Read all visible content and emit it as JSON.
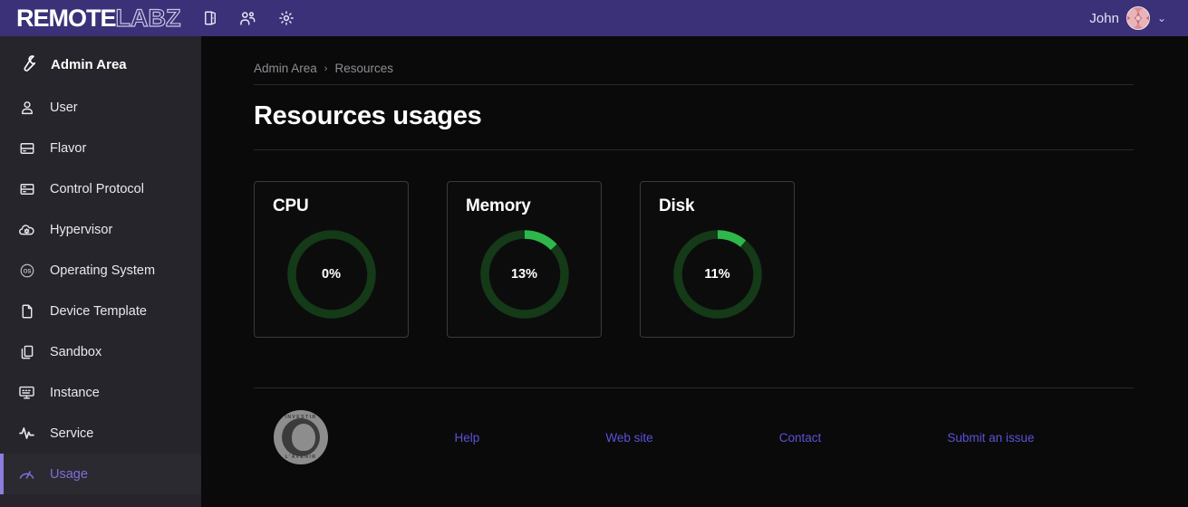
{
  "navbar": {
    "brand_primary": "REMOTE",
    "brand_secondary": "LABZ",
    "icons": [
      {
        "name": "door-exit-icon"
      },
      {
        "name": "users-group-icon"
      },
      {
        "name": "gear-icon"
      }
    ],
    "user_name": "John",
    "caret": "⌄",
    "background_color": "#3b3178"
  },
  "sidebar": {
    "header": {
      "label": "Admin Area",
      "icon": "wrench-icon"
    },
    "active_color": "#7e6fd6",
    "items": [
      {
        "label": "User",
        "icon": "person-icon",
        "active": false
      },
      {
        "label": "Flavor",
        "icon": "server-icon",
        "active": false
      },
      {
        "label": "Control Protocol",
        "icon": "server-icon",
        "active": false
      },
      {
        "label": "Hypervisor",
        "icon": "cloud-cog-icon",
        "active": false
      },
      {
        "label": "Operating System",
        "icon": "os-circle-icon",
        "active": false
      },
      {
        "label": "Device Template",
        "icon": "file-icon",
        "active": false
      },
      {
        "label": "Sandbox",
        "icon": "copy-icon",
        "active": false
      },
      {
        "label": "Instance",
        "icon": "monitor-icon",
        "active": false
      },
      {
        "label": "Service",
        "icon": "activity-pulse-icon",
        "active": false
      },
      {
        "label": "Usage",
        "icon": "gauge-icon",
        "active": true
      }
    ]
  },
  "main": {
    "breadcrumb": [
      "Admin Area",
      "Resources"
    ],
    "breadcrumb_separator": "›",
    "page_title": "Resources usages"
  },
  "chart_data": {
    "type": "pie",
    "title": "Resources usages",
    "charts": [
      {
        "title": "CPU",
        "value": 0,
        "label": "0%",
        "max": 100,
        "arc_color": "#2eb84c",
        "track_color": "#143a18"
      },
      {
        "title": "Memory",
        "value": 13,
        "label": "13%",
        "max": 100,
        "arc_color": "#2eb84c",
        "track_color": "#143a18"
      },
      {
        "title": "Disk",
        "value": 11,
        "label": "11%",
        "max": 100,
        "arc_color": "#2eb84c",
        "track_color": "#143a18"
      }
    ]
  },
  "footer": {
    "logo": {
      "text_top": "INVESTIR",
      "text_bottom": "L'AVENIR",
      "icon": "investir-avenir-badge"
    },
    "links": [
      "Help",
      "Web site",
      "Contact",
      "Submit an issue"
    ],
    "link_color": "#5b52d6"
  }
}
